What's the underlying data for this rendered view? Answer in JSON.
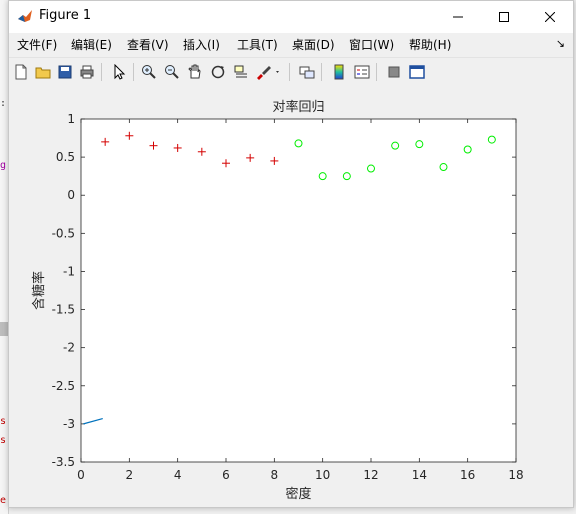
{
  "window": {
    "title": "Figure 1"
  },
  "menu": [
    "文件(F)",
    "编辑(E)",
    "查看(V)",
    "插入(I)",
    "工具(T)",
    "桌面(D)",
    "窗口(W)",
    "帮助(H)"
  ],
  "toolbar_icons": [
    "new-file-icon",
    "open-folder-icon",
    "save-icon",
    "print-icon",
    "pointer-icon",
    "zoom-in-icon",
    "zoom-out-icon",
    "pan-icon",
    "rotate-icon",
    "data-cursor-icon",
    "brush-icon",
    "link-icon",
    "colorbar-icon",
    "legend-icon",
    "hide-tools-icon",
    "dock-icon"
  ],
  "plot": {
    "title": "对率回归",
    "xlabel": "密度",
    "ylabel": "含糖率",
    "xticks": [
      "0",
      "2",
      "4",
      "6",
      "8",
      "10",
      "12",
      "14",
      "16",
      "18"
    ],
    "yticks": [
      "1",
      "0.5",
      "0",
      "-0.5",
      "-1",
      "-1.5",
      "-2",
      "-2.5",
      "-3",
      "-3.5"
    ]
  },
  "chart_data": {
    "type": "scatter",
    "title": "对率回归",
    "xlabel": "密度",
    "ylabel": "含糖率",
    "xlim": [
      0,
      18
    ],
    "ylim": [
      -3.5,
      1
    ],
    "grid": false,
    "series": [
      {
        "marker": "+",
        "color": "#d40000",
        "x": [
          1,
          2,
          3,
          4,
          5,
          6,
          7,
          8
        ],
        "y": [
          0.7,
          0.78,
          0.65,
          0.62,
          0.57,
          0.42,
          0.49,
          0.45
        ]
      },
      {
        "marker": "o",
        "color": "#00ee00",
        "x": [
          9,
          10,
          11,
          12,
          13,
          14,
          15,
          16,
          17
        ],
        "y": [
          0.68,
          0.25,
          0.25,
          0.35,
          0.65,
          0.67,
          0.37,
          0.6,
          0.73
        ]
      },
      {
        "marker": "line",
        "color": "#0072bd",
        "x": [
          0.1,
          0.9
        ],
        "y": [
          -3.0,
          -2.93
        ]
      }
    ]
  }
}
